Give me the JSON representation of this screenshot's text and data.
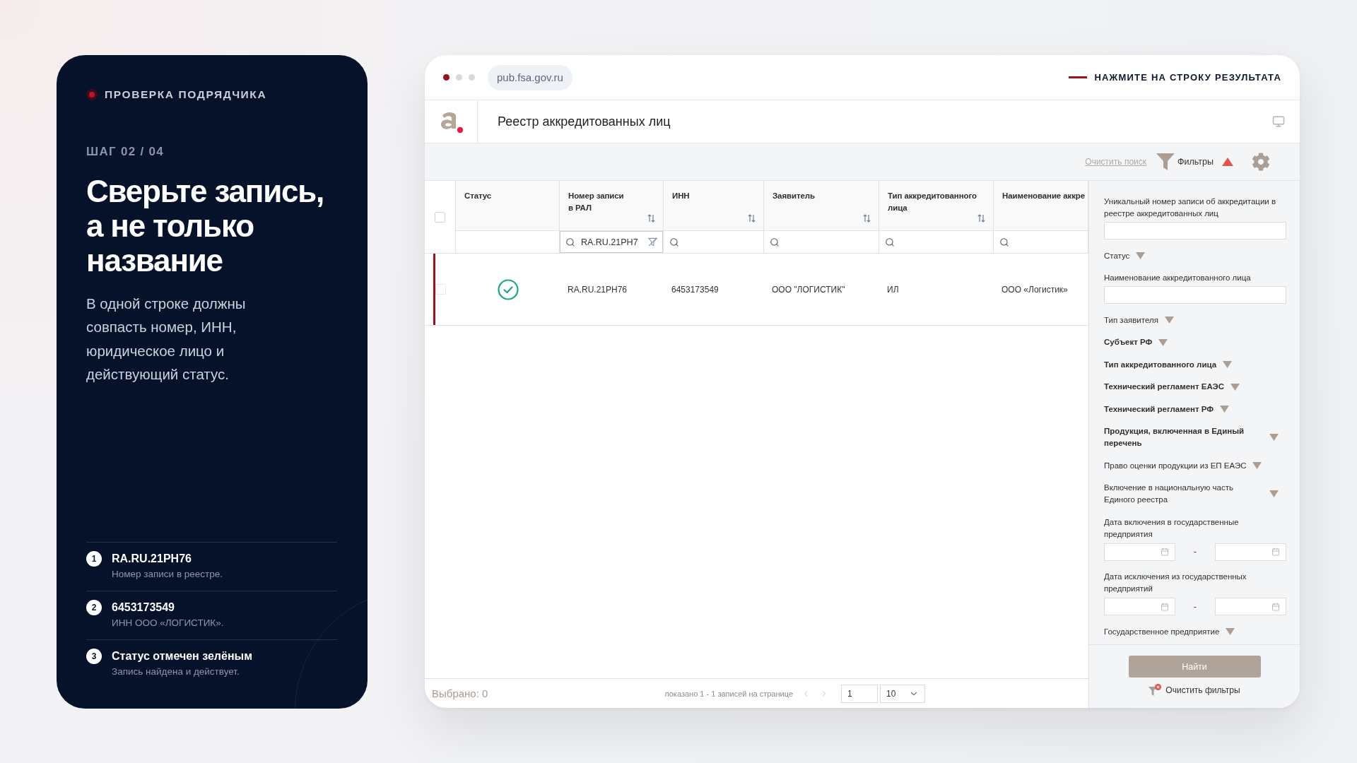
{
  "guide": {
    "tag": "ПРОВЕРКА ПОДРЯДЧИКА",
    "step": "ШАГ 02 / 04",
    "title": "Сверьте запись, а не только название",
    "text": "В одной строке должны совпасть номер, ИНН, юридическое лицо и действующий статус.",
    "checks": [
      {
        "number": "1",
        "value": "RA.RU.21PH76",
        "note": "Номер записи в реестре."
      },
      {
        "number": "2",
        "value": "6453173549",
        "note": "ИНН ООО «ЛОГИСТИК»."
      },
      {
        "number": "3",
        "value": "Статус отмечен зелёным",
        "note": "Запись найдена и действует."
      }
    ]
  },
  "browser": {
    "url": "pub.fsa.gov.ru",
    "hint": "НАЖМИТЕ НА СТРОКУ РЕЗУЛЬТАТА"
  },
  "app": {
    "title": "Реестр аккредитованных лиц",
    "toolbar": {
      "clear_search": "Очистить поиск",
      "filters": "Фильтры",
      "filters_open": true
    }
  },
  "table": {
    "select_all_checked": false,
    "columns": [
      {
        "label": "Статус",
        "kind": "status",
        "sortable": false
      },
      {
        "label": "Номер записи в РАЛ",
        "kind": "text",
        "sortable": true
      },
      {
        "label": "ИНН",
        "kind": "text",
        "sortable": true
      },
      {
        "label": "Заявитель",
        "kind": "text",
        "sortable": true
      },
      {
        "label": "Тип аккредитованного лица",
        "kind": "text",
        "sortable": true
      },
      {
        "label": "Наименование аккре",
        "kind": "text",
        "sortable": false
      }
    ],
    "column_filters": [
      {
        "kind": "none"
      },
      {
        "kind": "search",
        "value": "RA.RU.21PH7"
      },
      {
        "kind": "search"
      },
      {
        "kind": "search"
      },
      {
        "kind": "search"
      },
      {
        "kind": "search"
      }
    ],
    "rows": [
      {
        "checked": false,
        "highlighted": true,
        "active": true,
        "cells": [
          "",
          "RA.RU.21PH76",
          "6453173549",
          "ООО \"ЛОГИСТИК\"",
          "ИЛ",
          "ООО «Логистик»"
        ]
      }
    ]
  },
  "footer": {
    "selected": "Выбрано: 0",
    "shown": "показано 1 - 1 записей на странице",
    "page": "1",
    "page_size": "10"
  },
  "filter_panel": {
    "fields": [
      {
        "kind": "text",
        "label": "Уникальный номер записи об аккредитации в реестре аккредитованных лиц"
      },
      {
        "kind": "dropdown",
        "label": "Статус",
        "bold": false
      },
      {
        "kind": "text",
        "label": "Наименование аккредитованного лица"
      },
      {
        "kind": "dropdown",
        "label": "Тип заявителя",
        "bold": false
      },
      {
        "kind": "dropdown",
        "label": "Субъект РФ",
        "bold": true
      },
      {
        "kind": "dropdown",
        "label": "Тип аккредитованного лица",
        "bold": true
      },
      {
        "kind": "dropdown",
        "label": "Технический регламент ЕАЭС",
        "bold": true
      },
      {
        "kind": "dropdown",
        "label": "Технический регламент РФ",
        "bold": true
      },
      {
        "kind": "dropdown",
        "label": "Продукция, включенная в Единый перечень",
        "bold": true
      },
      {
        "kind": "dropdown",
        "label": "Право оценки продукции из ЕП ЕАЭС",
        "bold": false
      },
      {
        "kind": "dropdown",
        "label": "Включение в национальную часть Единого реестра",
        "bold": false
      },
      {
        "kind": "date_range",
        "label": "Дата включения в государственные предприятия",
        "separator": "-"
      },
      {
        "kind": "date_range",
        "label": "Дата исключения из государственных предприятий",
        "separator": "-"
      },
      {
        "kind": "dropdown",
        "label": "Государственное предприятие",
        "bold": false
      }
    ],
    "search_button": "Найти",
    "clear_filters": "Очистить фильтры"
  }
}
